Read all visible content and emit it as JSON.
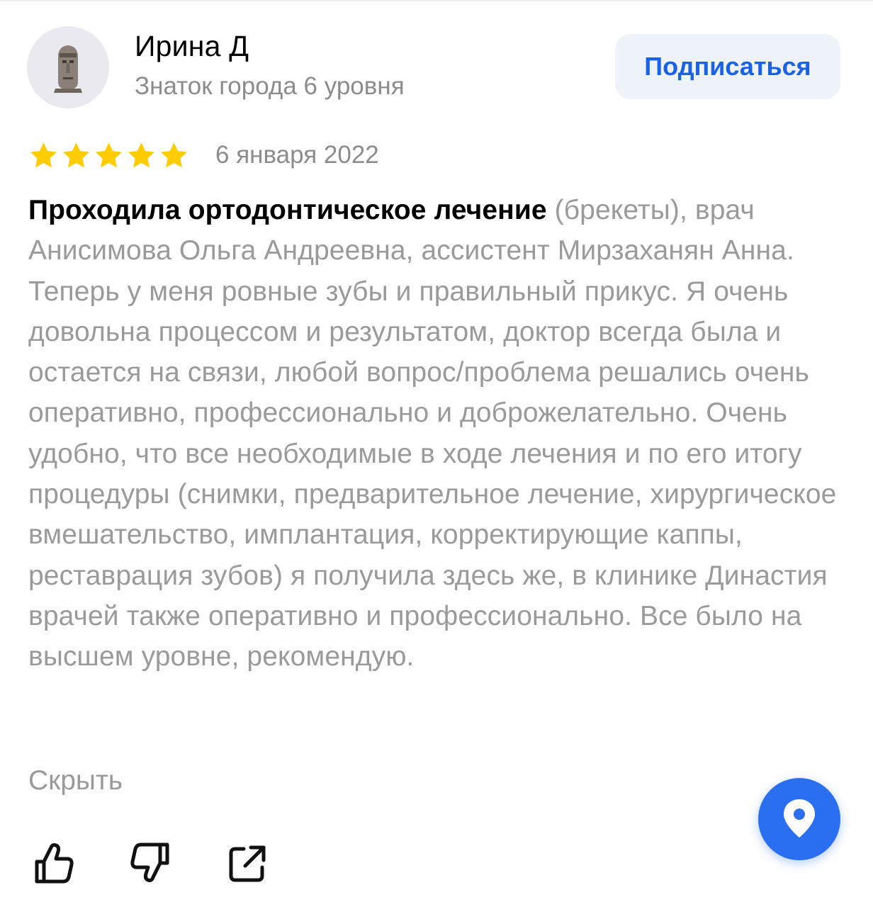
{
  "author": {
    "name": "Ирина Д",
    "level": "Знаток города 6 уровня"
  },
  "subscribe_label": "Подписаться",
  "review": {
    "rating": 5,
    "max_rating": 5,
    "date": "6 января 2022",
    "lead": "Проходила ортодонтическое лечение",
    "text": " (брекеты), врач Анисимова Ольга Андреевна, ассистент Мирзаханян Анна. Теперь у меня ровные зубы и правильный прикус. Я очень довольна процессом и результатом, доктор всегда была и остается на связи, любой вопрос/проблема решались очень оперативно, профессионально и доброжелательно. Очень удобно, что все необходимые в ходе лечения и по его итогу процедуры (снимки, предварительное лечение, хирургическое вмешательство, имплантация, корректирующие каппы, реставрация зубов) я получила здесь же, в клинике Династия врачей также оперативно и профессионально. Все было на высшем уровне, рекомендую."
  },
  "hide_label": "Скрыть",
  "colors": {
    "accent": "#1b61e4",
    "star": "#ffcc00",
    "muted_text": "#9a9a9a",
    "fab": "#2a6ff0"
  },
  "icons": {
    "like": "thumbs-up-icon",
    "dislike": "thumbs-down-icon",
    "share": "share-icon",
    "fab": "map-pin-icon"
  }
}
